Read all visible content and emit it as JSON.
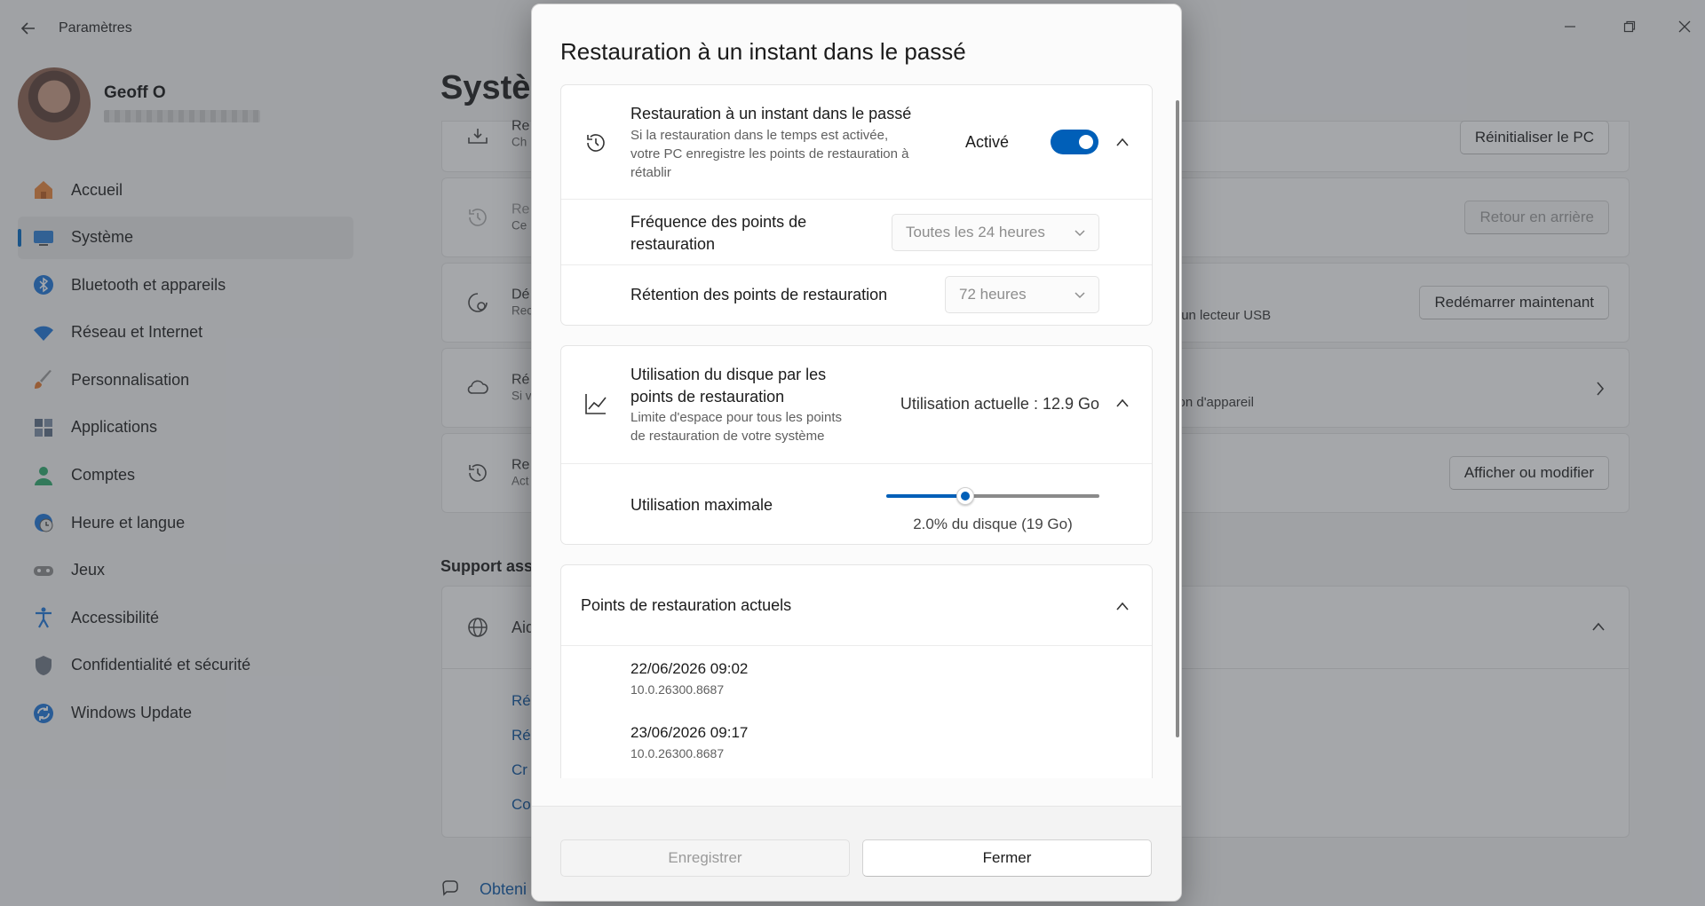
{
  "app": {
    "title": "Paramètres",
    "page_title": "Système",
    "user_name": "Geoff O"
  },
  "nav": [
    {
      "label": "Accueil",
      "icon": "home-icon"
    },
    {
      "label": "Système",
      "icon": "system-icon",
      "active": true
    },
    {
      "label": "Bluetooth et appareils",
      "icon": "bluetooth-icon"
    },
    {
      "label": "Réseau et Internet",
      "icon": "network-icon"
    },
    {
      "label": "Personnalisation",
      "icon": "brush-icon"
    },
    {
      "label": "Applications",
      "icon": "apps-icon"
    },
    {
      "label": "Comptes",
      "icon": "accounts-icon"
    },
    {
      "label": "Heure et langue",
      "icon": "time-language-icon"
    },
    {
      "label": "Jeux",
      "icon": "gaming-icon"
    },
    {
      "label": "Accessibilité",
      "icon": "accessibility-icon"
    },
    {
      "label": "Confidentialité et sécurité",
      "icon": "shield-icon"
    },
    {
      "label": "Windows Update",
      "icon": "update-icon"
    }
  ],
  "bg_cards": {
    "c1_title": "Re",
    "c1_sub": "Ch",
    "c1_button": "Réinitialiser le PC",
    "c2_title": "Re",
    "c2_sub": "Ce",
    "c2_button": "Retour en arrière",
    "c3_title": "Dé",
    "c3_sub": "Rec",
    "c3_right": "d'un lecteur USB",
    "c3_button": "Redémarrer maintenant",
    "c4_title": "Ré",
    "c4_sub": "Si v",
    "c4_right": "tion d'appareil",
    "c5_title": "Re",
    "c5_sub": "Act",
    "c5_button": "Afficher ou modifier",
    "support_label": "Support ass",
    "support_title": "Aid",
    "links": [
      "Ré",
      "Ré",
      "Cr",
      "Co"
    ],
    "bottom_link": "Obteni"
  },
  "dialog": {
    "title": "Restauration à un instant dans le passé",
    "restore": {
      "title": "Restauration à un instant dans le passé",
      "desc_line1": "Si la restauration dans le temps est activée,",
      "desc_line2": "votre PC enregistre les points de restauration à",
      "desc_line3": "rétablir",
      "status": "Activé",
      "enabled": true
    },
    "frequency": {
      "label_line1": "Fréquence des points de",
      "label_line2": "restauration",
      "value": "Toutes les 24 heures"
    },
    "retention": {
      "label": "Rétention des points de restauration",
      "value": "72 heures"
    },
    "disk": {
      "title_line1": "Utilisation du disque par les",
      "title_line2": "points de restauration",
      "desc_line1": "Limite d'espace pour tous les points",
      "desc_line2": "de restauration de votre système",
      "current": "Utilisation actuelle : 12.9 Go"
    },
    "max_usage": {
      "label": "Utilisation maximale",
      "caption": "2.0% du disque (19 Go)",
      "slider_fraction": 0.37
    },
    "points": {
      "header": "Points de restauration actuels",
      "items": [
        {
          "date": "22/06/2026 09:02",
          "version": "10.0.26300.8687"
        },
        {
          "date": "23/06/2026 09:17",
          "version": "10.0.26300.8687"
        }
      ]
    },
    "buttons": {
      "save": "Enregistrer",
      "close": "Fermer"
    }
  },
  "colors": {
    "accent": "#005fb8",
    "overlay": "#3c4048"
  }
}
